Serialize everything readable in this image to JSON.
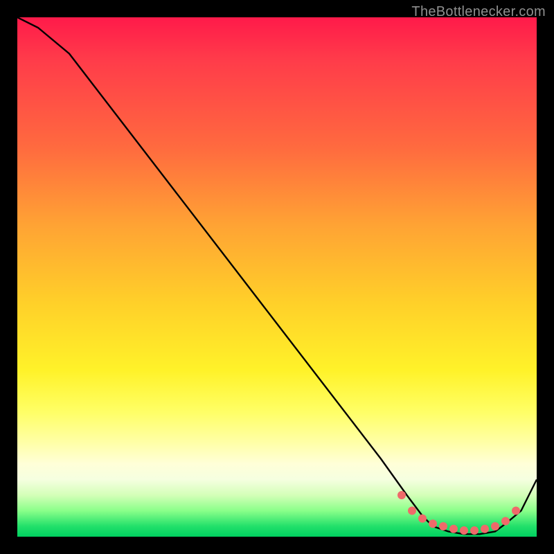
{
  "attribution": "TheBottlenecker.com",
  "chart_data": {
    "type": "line",
    "title": "",
    "xlabel": "",
    "ylabel": "",
    "xlim": [
      0,
      100
    ],
    "ylim": [
      0,
      100
    ],
    "series": [
      {
        "name": "curve",
        "x": [
          0,
          4,
          10,
          20,
          30,
          40,
          50,
          60,
          70,
          75,
          78,
          80,
          83,
          86,
          89,
          92,
          94,
          97,
          100
        ],
        "y": [
          100,
          98,
          93,
          80,
          67,
          54,
          41,
          28,
          15,
          8,
          4,
          2,
          1,
          0.5,
          0.5,
          1,
          2.5,
          5,
          11
        ]
      }
    ],
    "markers": {
      "name": "highlight-dots",
      "x": [
        74,
        76,
        78,
        80,
        82,
        84,
        86,
        88,
        90,
        92,
        94,
        96
      ],
      "y": [
        8,
        5,
        3.5,
        2.5,
        2,
        1.5,
        1.2,
        1.2,
        1.5,
        2,
        3,
        5
      ],
      "color": "#ef6a6a",
      "radius": 6
    },
    "gradient_stops": [
      {
        "pos": 0,
        "color": "#ff1a4a"
      },
      {
        "pos": 25,
        "color": "#ff6a3f"
      },
      {
        "pos": 55,
        "color": "#ffd029"
      },
      {
        "pos": 80,
        "color": "#ffff90"
      },
      {
        "pos": 95,
        "color": "#8aff8a"
      },
      {
        "pos": 100,
        "color": "#00d060"
      }
    ]
  }
}
